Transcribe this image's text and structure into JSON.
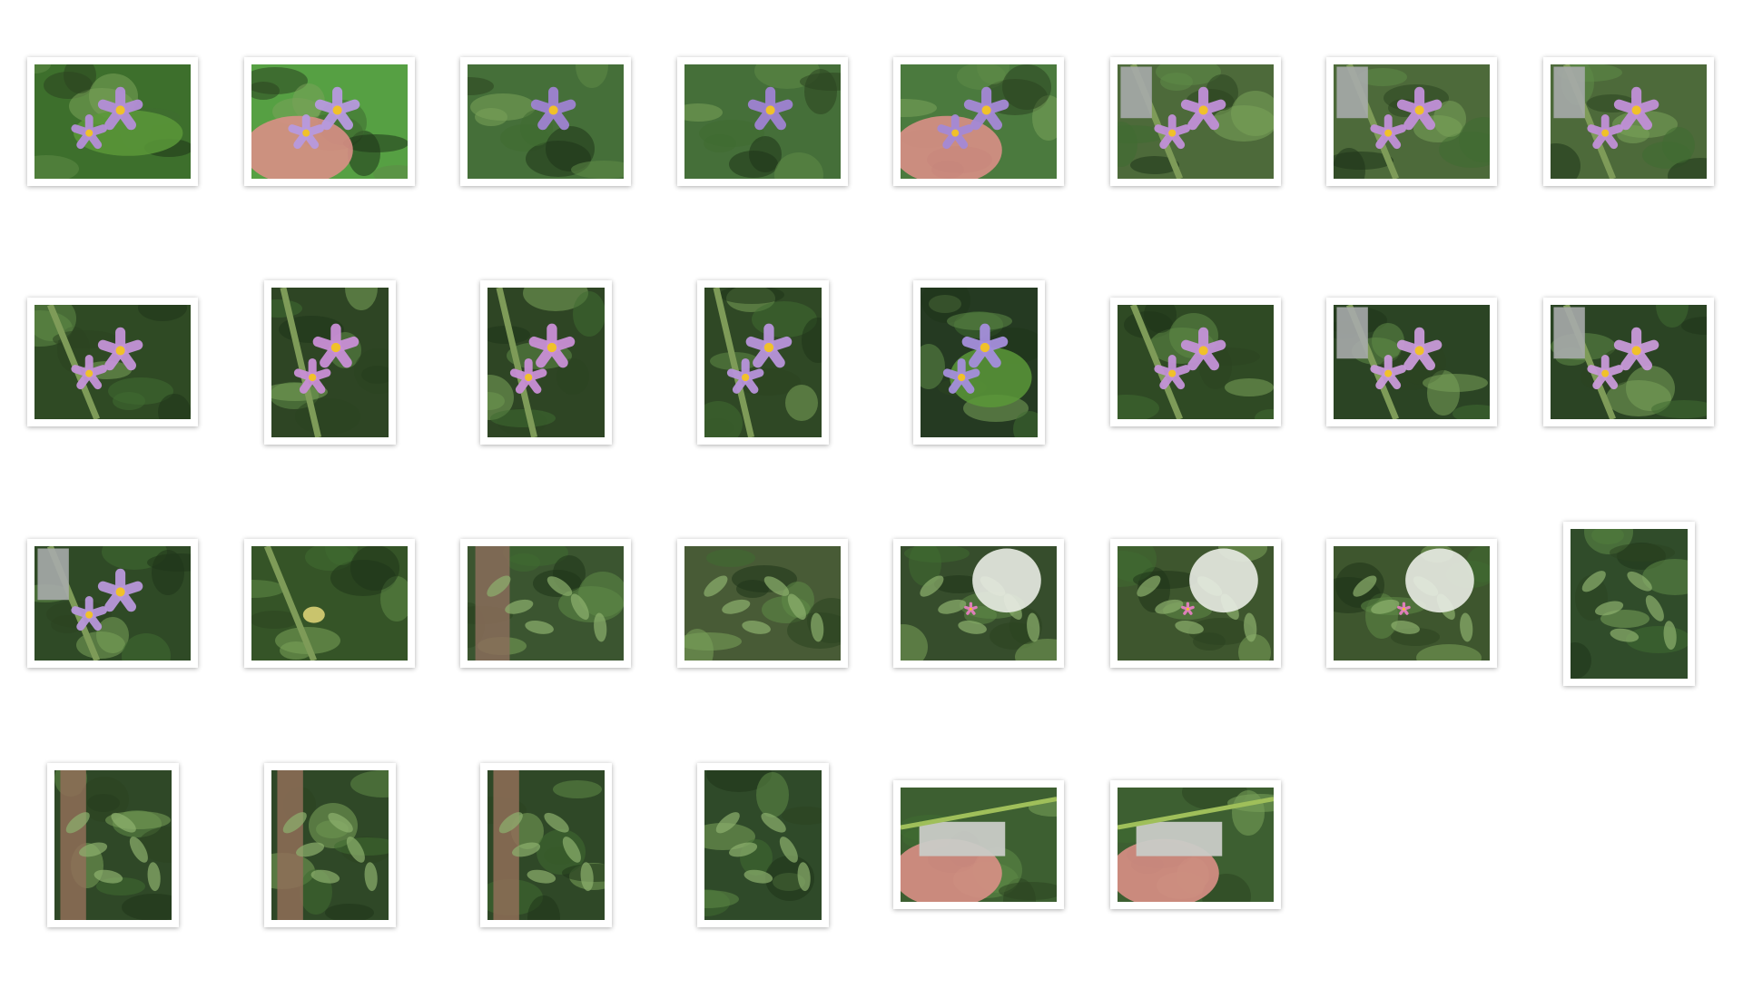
{
  "gallery": {
    "items": [
      {
        "orientation": "landscape",
        "subject": "flower-leaf",
        "palette": {
          "bg": "#3d6f2c",
          "accent": "#b48ed8"
        }
      },
      {
        "orientation": "landscape",
        "subject": "flower-hand",
        "palette": {
          "bg": "#56a043",
          "accent": "#b79adf"
        }
      },
      {
        "orientation": "landscape",
        "subject": "flower-front",
        "palette": {
          "bg": "#456f39",
          "accent": "#9f83d2"
        }
      },
      {
        "orientation": "landscape",
        "subject": "flower-front",
        "palette": {
          "bg": "#456f39",
          "accent": "#9f83d2"
        }
      },
      {
        "orientation": "landscape",
        "subject": "flower-hand",
        "palette": {
          "bg": "#4b7a3e",
          "accent": "#a589d6"
        }
      },
      {
        "orientation": "landscape",
        "subject": "flower-ruler",
        "palette": {
          "bg": "#4d6a3a",
          "accent": "#c190d8"
        }
      },
      {
        "orientation": "landscape",
        "subject": "flower-ruler",
        "palette": {
          "bg": "#4d6a3a",
          "accent": "#c190d8"
        }
      },
      {
        "orientation": "landscape",
        "subject": "flower-ruler",
        "palette": {
          "bg": "#4d6a3a",
          "accent": "#c190d8"
        }
      },
      {
        "orientation": "landscape",
        "subject": "flower-stem",
        "palette": {
          "bg": "#2f4a24",
          "accent": "#c493d8"
        }
      },
      {
        "orientation": "portrait",
        "subject": "flower-stem",
        "palette": {
          "bg": "#2e4524",
          "accent": "#c98fd6"
        }
      },
      {
        "orientation": "portrait",
        "subject": "flower-stem",
        "palette": {
          "bg": "#2e4524",
          "accent": "#c98fd6"
        }
      },
      {
        "orientation": "portrait",
        "subject": "flower-stem",
        "palette": {
          "bg": "#2f4825",
          "accent": "#b894db"
        }
      },
      {
        "orientation": "portrait",
        "subject": "flower-leaf",
        "palette": {
          "bg": "#253a22",
          "accent": "#a58fdc"
        }
      },
      {
        "orientation": "landscape",
        "subject": "flower-stem",
        "palette": {
          "bg": "#2f4a24",
          "accent": "#c493d8"
        }
      },
      {
        "orientation": "landscape",
        "subject": "flower-ruler",
        "palette": {
          "bg": "#2b4424",
          "accent": "#c99ad9"
        }
      },
      {
        "orientation": "landscape",
        "subject": "flower-ruler",
        "palette": {
          "bg": "#2b4424",
          "accent": "#c99ad9"
        }
      },
      {
        "orientation": "landscape",
        "subject": "flower-ruler",
        "palette": {
          "bg": "#2f4a26",
          "accent": "#b897db"
        }
      },
      {
        "orientation": "landscape",
        "subject": "bud",
        "palette": {
          "bg": "#355427",
          "accent": "#c9c46d"
        }
      },
      {
        "orientation": "landscape",
        "subject": "forest-trunk",
        "palette": {
          "bg": "#3b5530",
          "accent": "#8a6d5a"
        }
      },
      {
        "orientation": "landscape",
        "subject": "forest",
        "palette": {
          "bg": "#485b36",
          "accent": "#a59d8b"
        }
      },
      {
        "orientation": "landscape",
        "subject": "forest-leaf",
        "palette": {
          "bg": "#364d2c",
          "accent": "#e57fc0"
        }
      },
      {
        "orientation": "landscape",
        "subject": "forest-leaf",
        "palette": {
          "bg": "#3e562e",
          "accent": "#e57fc0"
        }
      },
      {
        "orientation": "landscape",
        "subject": "forest-leaf",
        "palette": {
          "bg": "#3e562e",
          "accent": "#e57fc0"
        }
      },
      {
        "orientation": "portrait",
        "subject": "forest",
        "palette": {
          "bg": "#304c2a",
          "accent": "#6e7f4b"
        }
      },
      {
        "orientation": "portrait",
        "subject": "forest-trunk",
        "palette": {
          "bg": "#2f4827",
          "accent": "#8f6f58"
        }
      },
      {
        "orientation": "portrait",
        "subject": "forest-trunk",
        "palette": {
          "bg": "#2f4827",
          "accent": "#8f6f58"
        }
      },
      {
        "orientation": "portrait",
        "subject": "forest-trunk",
        "palette": {
          "bg": "#2f4827",
          "accent": "#8f6f58"
        }
      },
      {
        "orientation": "portrait",
        "subject": "forest",
        "palette": {
          "bg": "#2f4a29",
          "accent": "#b8d0a6"
        }
      },
      {
        "orientation": "landscape",
        "subject": "tag-hand",
        "palette": {
          "bg": "#3d5f31",
          "accent": "#c9cbc7"
        }
      },
      {
        "orientation": "landscape",
        "subject": "tag-hand",
        "palette": {
          "bg": "#3d5f31",
          "accent": "#c9cbc7"
        }
      }
    ]
  }
}
